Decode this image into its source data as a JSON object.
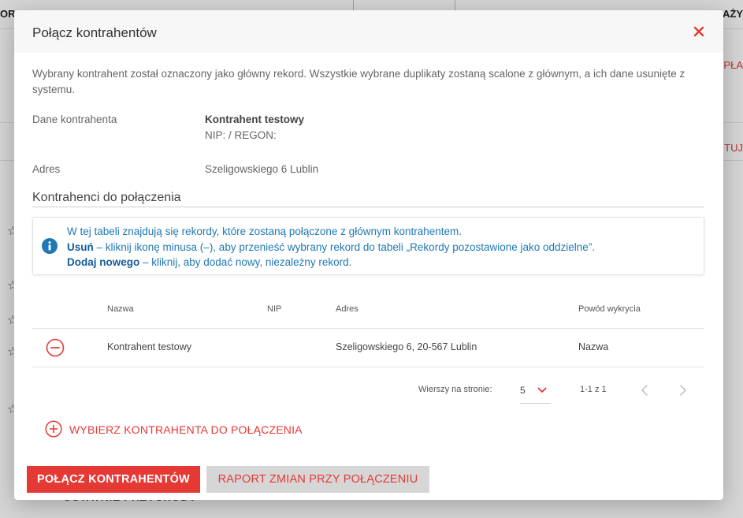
{
  "background": {
    "top_left": "OR",
    "top_right": "DAŻY",
    "right_red_1": "PŁA",
    "right_red_2": "TUJ",
    "bottom_title": "OSTATNIE PRZYCHODY",
    "star_glyph": "☆"
  },
  "modal": {
    "title": "Połącz kontrahentów",
    "intro": "Wybrany kontrahent został oznaczony jako główny rekord. Wszystkie wybrane duplikaty zostaną scalone z głównym, a ich dane usunięte z systemu.",
    "details": {
      "contractor_label": "Dane kontrahenta",
      "contractor_name": "Kontrahent testowy",
      "contractor_ids": "NIP: / REGON:",
      "address_label": "Adres",
      "address_value": "Szeligowskiego 6 Lublin"
    },
    "section_title": "Kontrahenci do połączenia",
    "info": {
      "line1": "W tej tabeli znajdują się rekordy, które zostaną połączone z głównym kontrahentem.",
      "line2_strong": "Usuń",
      "line2_rest": " – kliknij ikonę minusa (–), aby przenieść wybrany rekord do tabeli „Rekordy pozostawione jako oddzielne”.",
      "line3_strong": "Dodaj nowego",
      "line3_rest": " – kliknij, aby dodać nowy, niezależny rekord."
    },
    "table": {
      "headers": {
        "name": "Nazwa",
        "nip": "NIP",
        "address": "Adres",
        "reason": "Powód wykrycia"
      },
      "rows": [
        {
          "name": "Kontrahent testowy",
          "nip": "",
          "address": "Szeligowskiego 6, 20-567 Lublin",
          "reason": "Nazwa"
        }
      ]
    },
    "pagination": {
      "rows_per_page_label": "Wierszy na stronie:",
      "rows_per_page_value": "5",
      "range": "1-1 z 1"
    },
    "add_link_label": "WYBIERZ KONTRAHENTA DO POŁĄCZENIA",
    "buttons": {
      "primary": "POŁĄCZ KONTRAHENTÓW",
      "secondary": "RAPORT ZMIAN PRZY POŁĄCZENIU"
    }
  },
  "colors": {
    "accent_red": "#e53935",
    "info_blue": "#1f78b4",
    "secondary_button_bg": "#d6d6d6"
  },
  "icons": {
    "close": "close-icon",
    "info": "info-icon",
    "remove": "minus-circle-icon",
    "add": "plus-circle-icon",
    "dropdown": "chevron-down-icon",
    "prev": "chevron-left-icon",
    "next": "chevron-right-icon",
    "star": "star-outline-icon"
  }
}
